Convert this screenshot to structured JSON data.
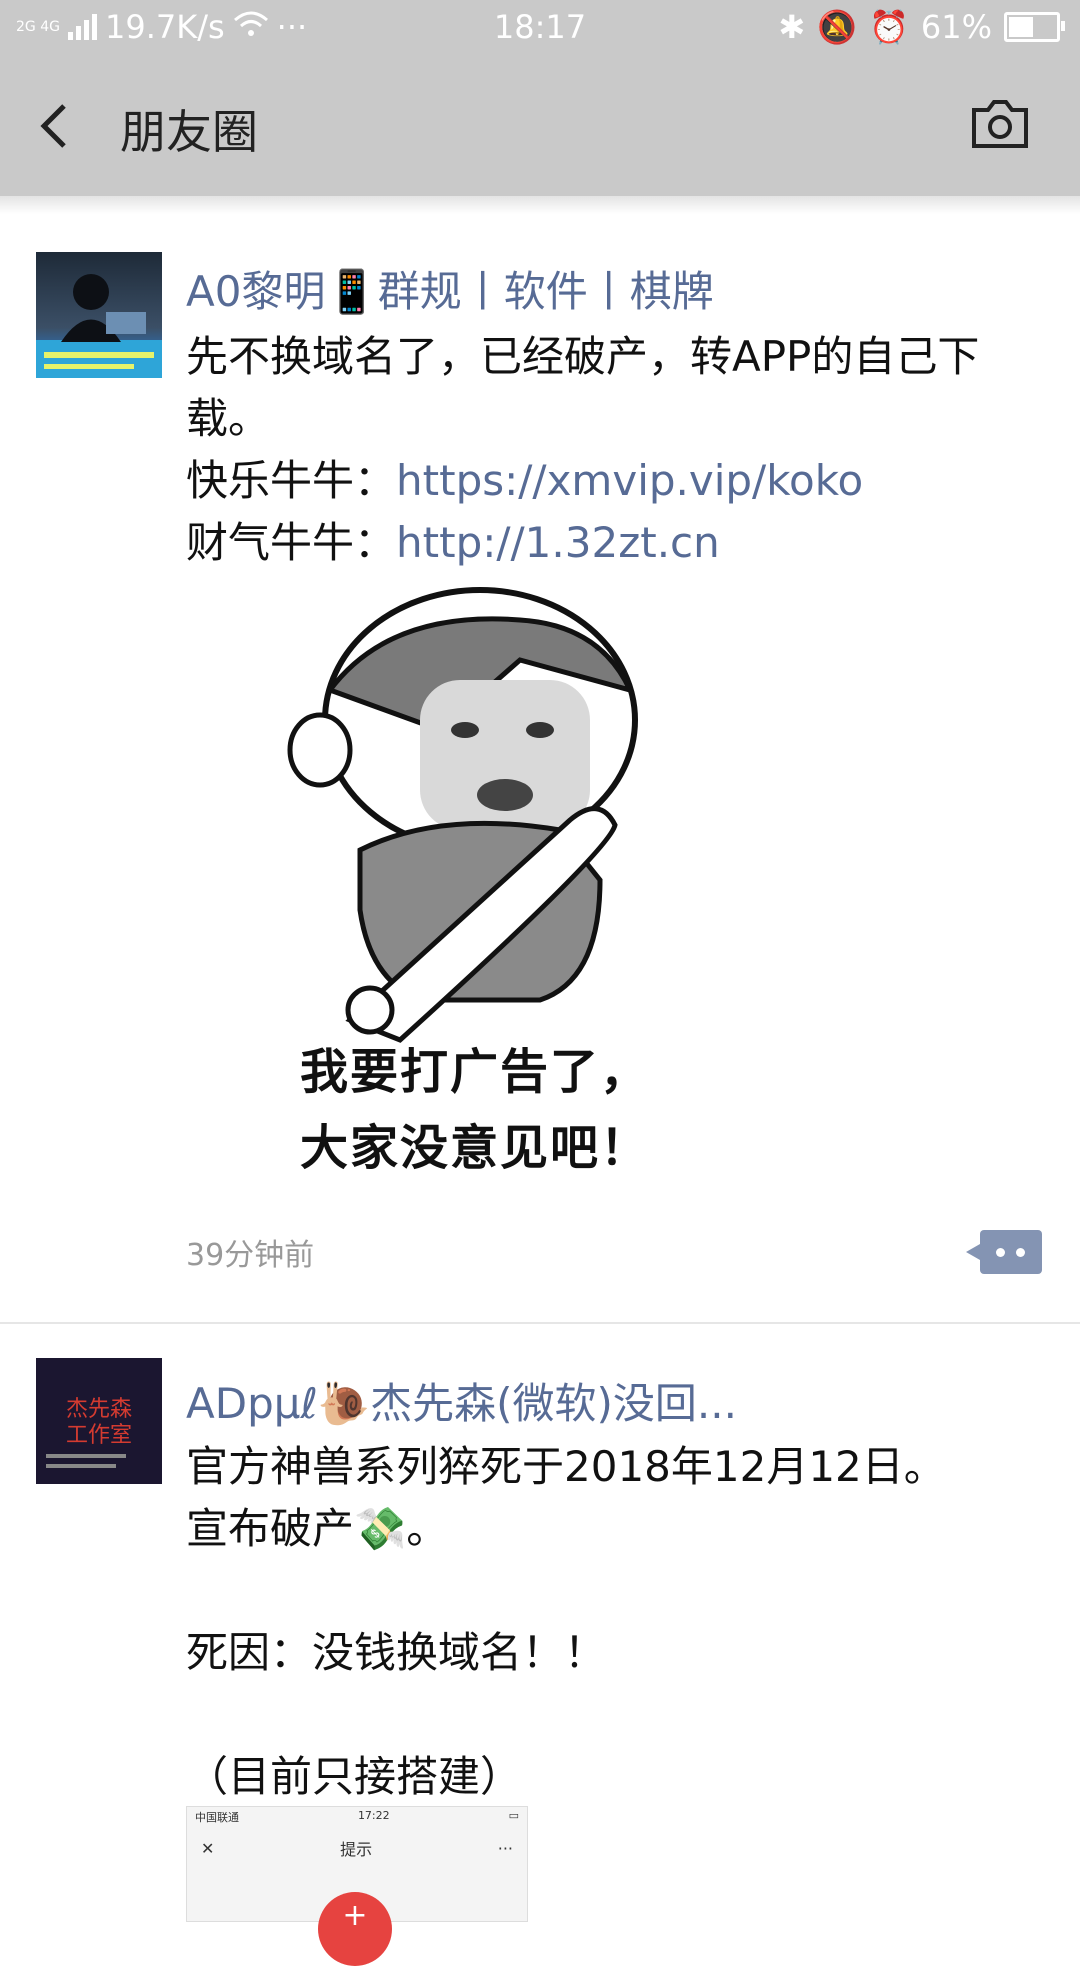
{
  "status_bar": {
    "network_labels": "2G 4G",
    "speed": "19.7K/s",
    "more": "···",
    "time": "18:17",
    "battery_text": "61%",
    "battery_level": 0.61
  },
  "nav": {
    "title": "朋友圈",
    "back_icon": "chevron-left-icon",
    "camera_icon": "camera-icon"
  },
  "posts": [
    {
      "author": "A0黎明📱群规丨软件丨棋牌",
      "text_lines": [
        "先不换域名了，已经破产，转APP的自己下载。"
      ],
      "link_rows": [
        {
          "label": "快乐牛牛：",
          "url": "https://xmvip.vip/koko"
        },
        {
          "label": "财气牛牛：",
          "url": "http://1.32zt.cn"
        }
      ],
      "image_caption": [
        "我要打广告了，",
        "大家没意见吧！"
      ],
      "time": "39分钟前"
    },
    {
      "author": "ADpμℓ🐌杰先森(微软)没回...",
      "text_lines": [
        "官方神兽系列猝死于2018年12月12日。",
        "宣布破产💸。",
        "",
        "死因：没钱换域名！！",
        "",
        "（目前只接搭建）"
      ],
      "mini_screenshot": {
        "carrier": "中国联通",
        "time": "17:22",
        "close": "✕",
        "title": "提示",
        "more": "···",
        "avatar_label": "杰先森 工作室"
      }
    }
  ],
  "colors": {
    "header_bg": "#c9c9c9",
    "name_blue": "#576b95",
    "comment_btn": "#8494b3"
  }
}
